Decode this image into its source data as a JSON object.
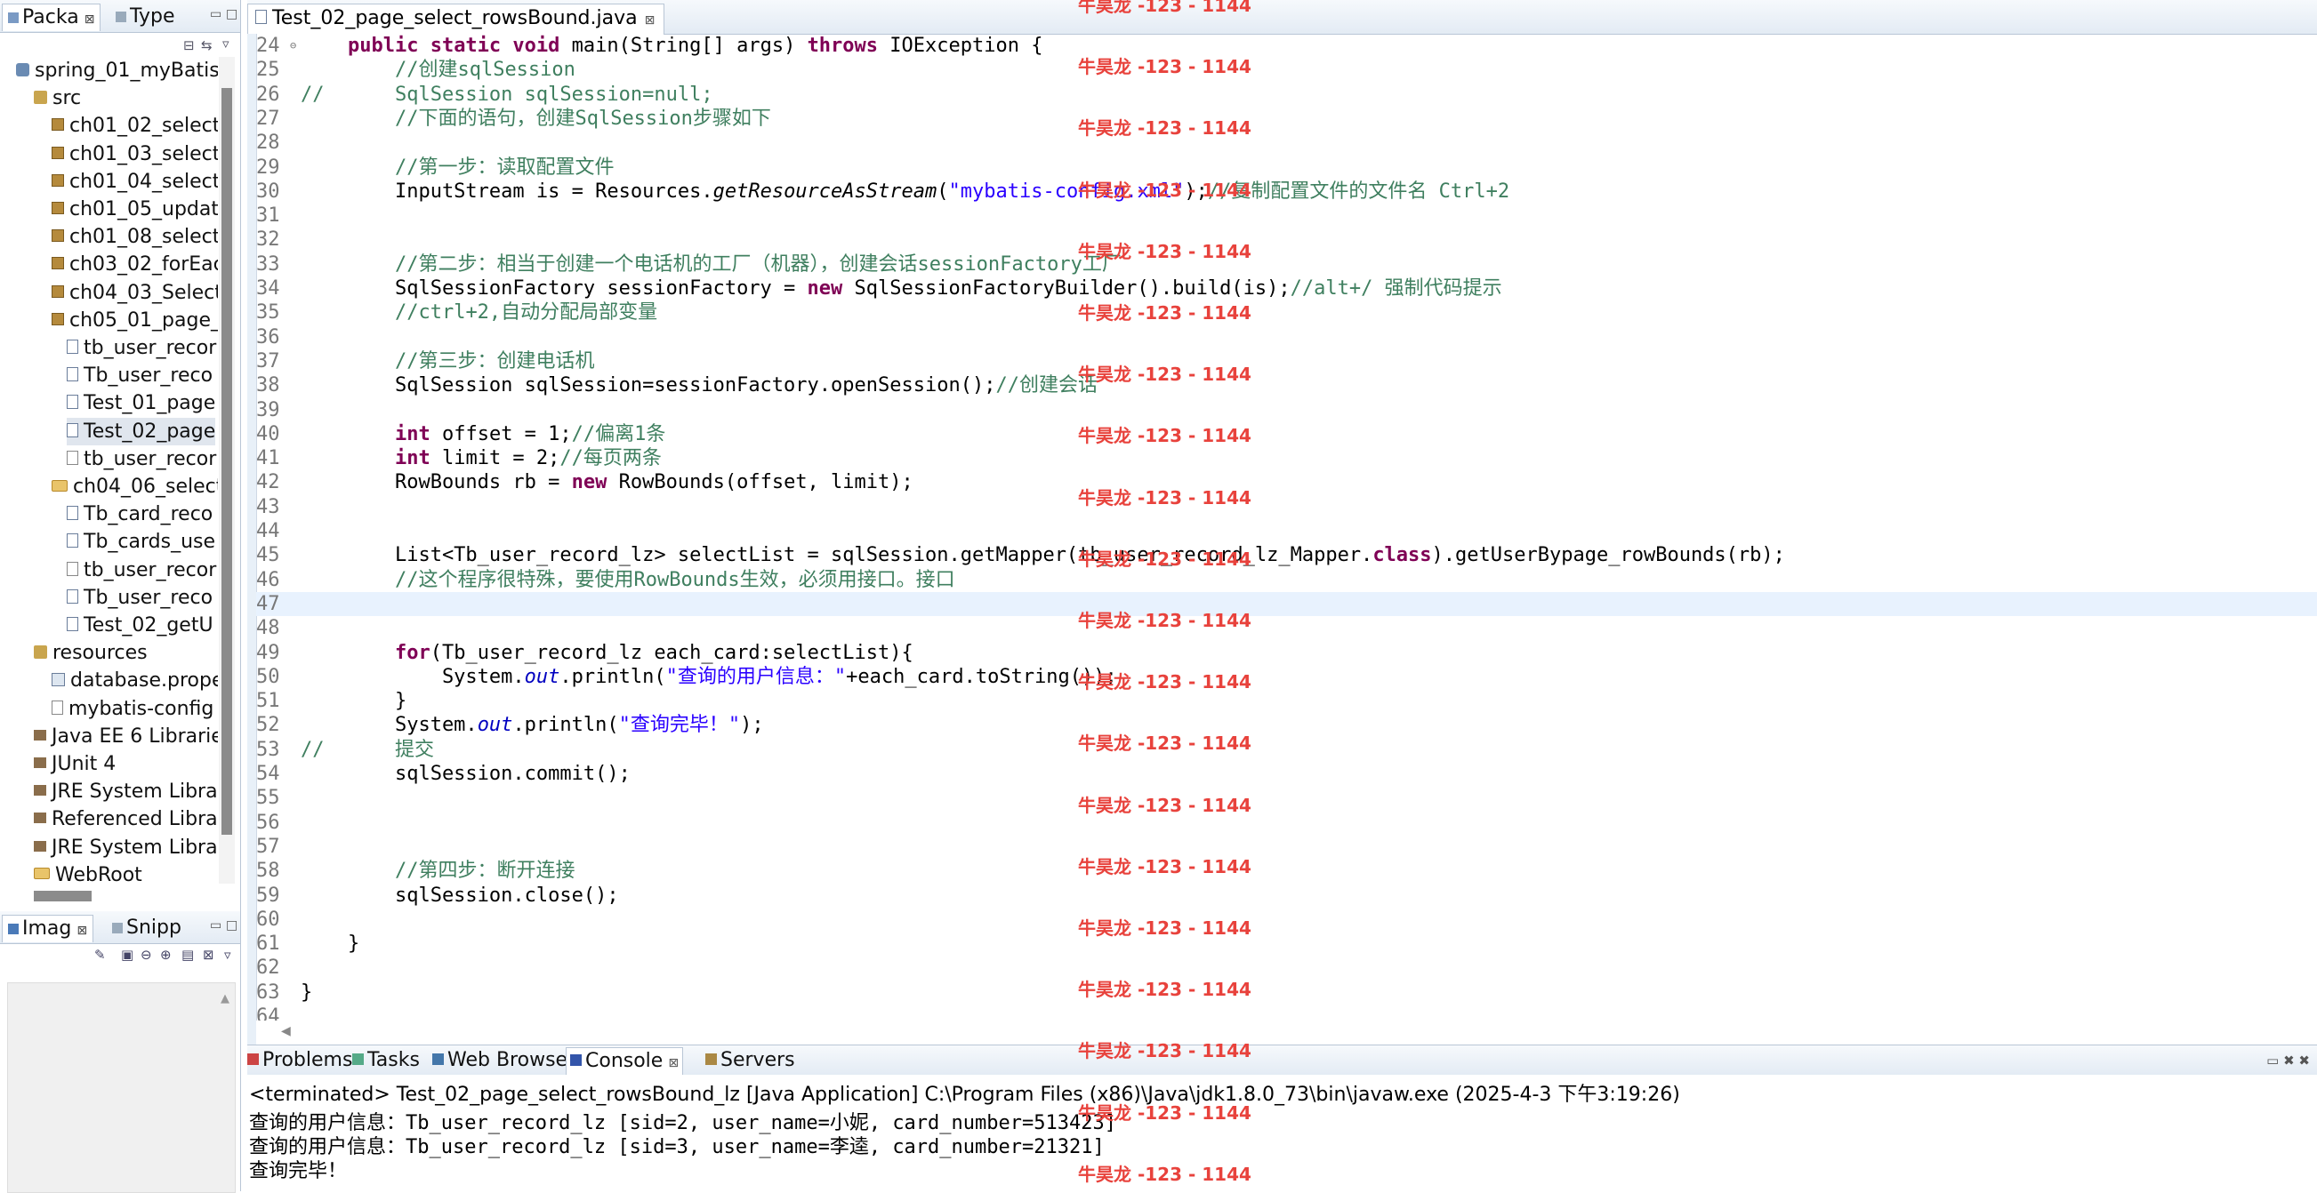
{
  "left_panel": {
    "tabs": [
      {
        "label": "Packa",
        "close": "⊠"
      },
      {
        "label": "Type"
      }
    ],
    "tree": [
      {
        "label": "spring_01_myBatis_",
        "icon": "project-icon"
      },
      {
        "label": "src",
        "icon": "source-folder-icon"
      },
      {
        "label": "ch01_02_select",
        "icon": "package-icon"
      },
      {
        "label": "ch01_03_select",
        "icon": "package-icon"
      },
      {
        "label": "ch01_04_select",
        "icon": "package-icon"
      },
      {
        "label": "ch01_05_updat",
        "icon": "package-icon"
      },
      {
        "label": "ch01_08_select",
        "icon": "package-icon"
      },
      {
        "label": "ch03_02_forEac",
        "icon": "package-icon"
      },
      {
        "label": "ch04_03_Select",
        "icon": "package-icon"
      },
      {
        "label": "ch05_01_page_",
        "icon": "package-icon"
      },
      {
        "label": "tb_user_recor",
        "icon": "java-file-icon"
      },
      {
        "label": "Tb_user_reco",
        "icon": "java-file-icon"
      },
      {
        "label": "Test_01_page",
        "icon": "java-file-icon"
      },
      {
        "label": "Test_02_page",
        "icon": "java-file-icon"
      },
      {
        "label": "tb_user_recor",
        "icon": "xml-file-icon"
      },
      {
        "label": "ch04_06_select",
        "icon": "package-open-icon"
      },
      {
        "label": "Tb_card_reco",
        "icon": "java-file-icon"
      },
      {
        "label": "Tb_cards_use",
        "icon": "java-file-icon"
      },
      {
        "label": "tb_user_recor",
        "icon": "xml-file-icon"
      },
      {
        "label": "Tb_user_reco",
        "icon": "java-file-icon"
      },
      {
        "label": "Test_02_getU",
        "icon": "java-file-icon"
      },
      {
        "label": "resources",
        "icon": "source-folder-icon"
      },
      {
        "label": "database.prope",
        "icon": "properties-file-icon"
      },
      {
        "label": "mybatis-config",
        "icon": "xml-file-icon"
      },
      {
        "label": "Java EE 6 Librarie",
        "icon": "library-icon"
      },
      {
        "label": "JUnit 4",
        "icon": "library-icon"
      },
      {
        "label": "JRE System Libra",
        "icon": "library-icon"
      },
      {
        "label": "Referenced Libra",
        "icon": "library-icon"
      },
      {
        "label": "JRE System Libra",
        "icon": "library-icon"
      },
      {
        "label": "WebRoot",
        "icon": "folder-icon"
      }
    ],
    "bottom_tabs": [
      {
        "label": "Imag",
        "close": "⊠"
      },
      {
        "label": "Snipp"
      }
    ]
  },
  "editor": {
    "tab_title": "Test_02_page_select_rowsBound.java",
    "tab_close": "⊠",
    "lines": [
      {
        "n": "24",
        "html": "    <span class=\"kw\">public static void</span> main(String[] args) <span class=\"kw\">throws</span> IOException {",
        "fold": "⊖"
      },
      {
        "n": "25",
        "html": "        <span class=\"cm\">//创建sqlSession</span>"
      },
      {
        "n": "26",
        "html": "<span class=\"cm\">//      SqlSession sqlSession=null;</span>"
      },
      {
        "n": "27",
        "html": "        <span class=\"cm\">//下面的语句，创建SqlSession步骤如下</span>"
      },
      {
        "n": "28",
        "html": ""
      },
      {
        "n": "29",
        "html": "        <span class=\"cm\">//第一步：读取配置文件</span>"
      },
      {
        "n": "30",
        "html": "        InputStream is = Resources.<span class=\"it\">getResourceAsStream</span>(<span class=\"st\">\"mybatis-config.xml\"</span>);<span class=\"cm\">//复制配置文件的文件名 Ctrl+2</span>"
      },
      {
        "n": "31",
        "html": ""
      },
      {
        "n": "32",
        "html": ""
      },
      {
        "n": "33",
        "html": "        <span class=\"cm\">//第二步：相当于创建一个电话机的工厂（机器），创建会话sessionFactory工厂</span>"
      },
      {
        "n": "34",
        "html": "        SqlSessionFactory sessionFactory = <span class=\"kw\">new</span> SqlSessionFactoryBuilder().build(is);<span class=\"cm\">//alt+/ 强制代码提示</span>"
      },
      {
        "n": "35",
        "html": "        <span class=\"cm\">//ctrl+2,自动分配局部变量</span>"
      },
      {
        "n": "36",
        "html": ""
      },
      {
        "n": "37",
        "html": "        <span class=\"cm\">//第三步：创建电话机</span>"
      },
      {
        "n": "38",
        "html": "        SqlSession sqlSession=sessionFactory.openSession();<span class=\"cm\">//创建会话</span>"
      },
      {
        "n": "39",
        "html": ""
      },
      {
        "n": "40",
        "html": "        <span class=\"kw\">int</span> offset = 1;<span class=\"cm\">//偏离1条</span>"
      },
      {
        "n": "41",
        "html": "        <span class=\"kw\">int</span> limit = 2;<span class=\"cm\">//每页两条</span>"
      },
      {
        "n": "42",
        "html": "        RowBounds rb = <span class=\"kw\">new</span> RowBounds(offset, limit);"
      },
      {
        "n": "43",
        "html": ""
      },
      {
        "n": "44",
        "html": ""
      },
      {
        "n": "45",
        "html": "        List&lt;Tb_user_record_lz&gt; selectList = sqlSession.getMapper(tb_user_record_lz_Mapper.<span class=\"kw\">class</span>).getUserBypage_rowBounds(rb);"
      },
      {
        "n": "46",
        "html": "        <span class=\"cm\">//这个程序很特殊，要使用RowBounds生效，必须用接口。接口</span>"
      },
      {
        "n": "47",
        "html": "",
        "highlight": true
      },
      {
        "n": "48",
        "html": ""
      },
      {
        "n": "49",
        "html": "        <span class=\"kw\">for</span>(Tb_user_record_lz each_card:selectList){"
      },
      {
        "n": "50",
        "html": "            System.<span class=\"fld\">out</span>.println(<span class=\"st\">\"查询的用户信息：\"</span>+each_card.toString());"
      },
      {
        "n": "51",
        "html": "        }"
      },
      {
        "n": "52",
        "html": "        System.<span class=\"fld\">out</span>.println(<span class=\"st\">\"查询完毕！\"</span>);"
      },
      {
        "n": "53",
        "html": "<span class=\"cm\">//      提交</span>"
      },
      {
        "n": "54",
        "html": "        sqlSession.commit();"
      },
      {
        "n": "55",
        "html": ""
      },
      {
        "n": "56",
        "html": ""
      },
      {
        "n": "57",
        "html": ""
      },
      {
        "n": "58",
        "html": "        <span class=\"cm\">//第四步：断开连接</span>"
      },
      {
        "n": "59",
        "html": "        sqlSession.close();"
      },
      {
        "n": "60",
        "html": ""
      },
      {
        "n": "61",
        "html": "    }"
      },
      {
        "n": "62",
        "html": ""
      },
      {
        "n": "63",
        "html": "}"
      },
      {
        "n": "64",
        "html": ""
      }
    ]
  },
  "console": {
    "tabs": [
      {
        "label": "Problems",
        "name": "tab-problems"
      },
      {
        "label": "Tasks",
        "name": "tab-tasks"
      },
      {
        "label": "Web Browser",
        "name": "tab-web-browser"
      },
      {
        "label": "Console",
        "name": "tab-console",
        "close": "⊠"
      },
      {
        "label": "Servers",
        "name": "tab-servers"
      }
    ],
    "header": "<terminated> Test_02_page_select_rowsBound_lz [Java Application] C:\\Program Files (x86)\\Java\\jdk1.8.0_73\\bin\\javaw.exe (2025-4-3 下午3:19:26)",
    "output": [
      "查询的用户信息：Tb_user_record_lz [sid=2, user_name=小妮, card_number=513423]",
      "查询的用户信息：Tb_user_record_lz [sid=3, user_name=李逵, card_number=21321]",
      "查询完毕！"
    ]
  },
  "watermark": {
    "text": "牛昊龙 -123 - 1144",
    "color": "#e8423c",
    "count": 20
  }
}
